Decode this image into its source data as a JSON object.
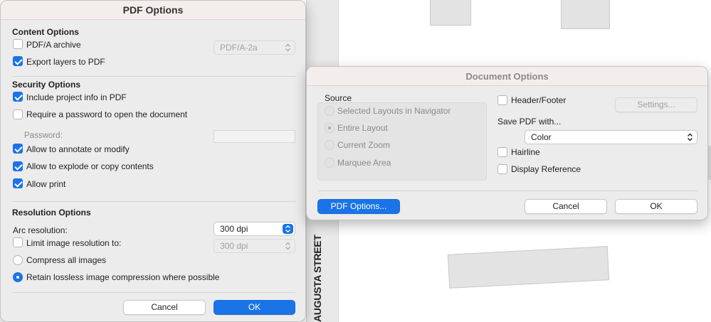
{
  "background": {
    "street_label": "AUGUSTA STREET"
  },
  "pdf_options": {
    "title": "PDF Options",
    "content": {
      "section_title": "Content Options",
      "pdfa_label": "PDF/A archive",
      "pdfa_checked": false,
      "pdfa_select_value": "PDF/A-2a",
      "export_layers_label": "Export layers to PDF",
      "export_layers_checked": true
    },
    "security": {
      "section_title": "Security Options",
      "include_info_label": "Include project info in PDF",
      "include_info_checked": true,
      "require_password_label": "Require a password to open the document",
      "require_password_checked": false,
      "password_label": "Password:",
      "password_value": "",
      "annotate_label": "Allow to annotate or modify",
      "annotate_checked": true,
      "explode_label": "Allow to explode or copy contents",
      "explode_checked": true,
      "print_label": "Allow print",
      "print_checked": true
    },
    "resolution": {
      "section_title": "Resolution Options",
      "arc_label": "Arc resolution:",
      "arc_value": "300 dpi",
      "limit_label": "Limit image resolution to:",
      "limit_checked": false,
      "limit_value": "300 dpi",
      "compress_label": "Compress all images",
      "retain_label": "Retain lossless image compression where possible",
      "selected_compression": "retain"
    },
    "buttons": {
      "cancel": "Cancel",
      "ok": "OK"
    }
  },
  "document_options": {
    "title": "Document Options",
    "source": {
      "label": "Source",
      "options": [
        "Selected Layouts in Navigator",
        "Entire Layout",
        "Current Zoom",
        "Marquee Area"
      ],
      "selected": "Entire Layout"
    },
    "header_footer_label": "Header/Footer",
    "header_footer_checked": false,
    "settings_button": "Settings...",
    "save_pdf_label": "Save PDF with...",
    "color_value": "Color",
    "hairline_label": "Hairline",
    "hairline_checked": false,
    "display_reference_label": "Display Reference",
    "display_reference_checked": false,
    "buttons": {
      "pdf_options": "PDF Options...",
      "cancel": "Cancel",
      "ok": "OK"
    }
  },
  "colors": {
    "accent": "#1a74e8",
    "dialog_bg": "#ececec",
    "titlebar_bg": "#f3eeec"
  }
}
